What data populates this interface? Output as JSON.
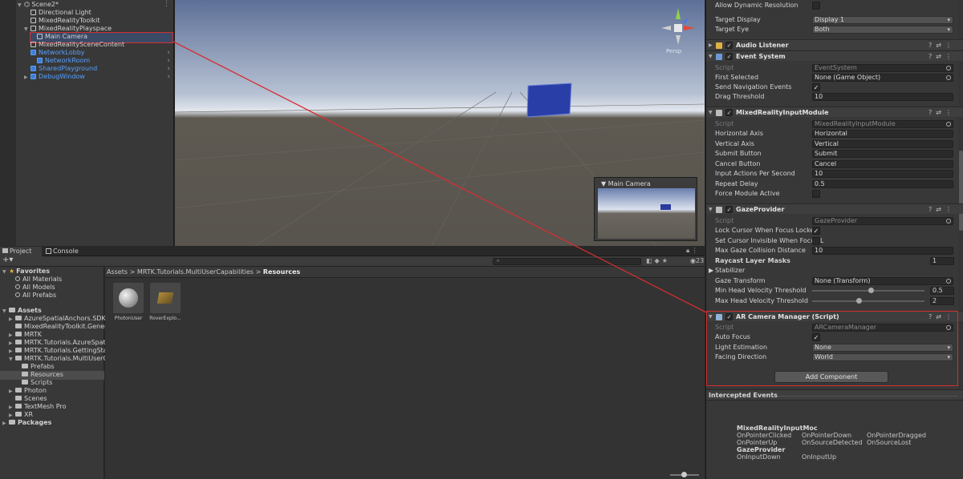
{
  "hierarchy": {
    "items": [
      {
        "label": "Scene2*",
        "type": "scene"
      },
      {
        "label": "Directional Light"
      },
      {
        "label": "MixedRealityToolkit"
      },
      {
        "label": "MixedRealityPlayspace"
      },
      {
        "label": "Main Camera"
      },
      {
        "label": "MixedRealitySceneContent"
      },
      {
        "label": "NetworkLobby"
      },
      {
        "label": "NetworkRoom"
      },
      {
        "label": "SharedPlayground"
      },
      {
        "label": "DebugWindow"
      }
    ]
  },
  "scene": {
    "gizmo_label": "Persp",
    "camera_preview_title": "Main Camera"
  },
  "bottom_tabs": {
    "project": "Project",
    "console": "Console"
  },
  "project": {
    "toolbar_count": "23",
    "tree": [
      {
        "label": "Favorites",
        "bold": true
      },
      {
        "label": "All Materials"
      },
      {
        "label": "All Models"
      },
      {
        "label": "All Prefabs"
      },
      {
        "label": "Assets",
        "bold": true
      },
      {
        "label": "AzureSpatialAnchors.SDK"
      },
      {
        "label": "MixedRealityToolkit.Generat"
      },
      {
        "label": "MRTK"
      },
      {
        "label": "MRTK.Tutorials.AzureSpatia"
      },
      {
        "label": "MRTK.Tutorials.GettingStart"
      },
      {
        "label": "MRTK.Tutorials.MultiUserCa"
      },
      {
        "label": "Prefabs"
      },
      {
        "label": "Resources"
      },
      {
        "label": "Scripts"
      },
      {
        "label": "Photon"
      },
      {
        "label": "Scenes"
      },
      {
        "label": "TextMesh Pro"
      },
      {
        "label": "XR"
      },
      {
        "label": "Packages",
        "bold": true
      }
    ],
    "breadcrumb": [
      "Assets",
      "MRTK.Tutorials.MultiUserCapabilities",
      "Resources"
    ],
    "assets": [
      {
        "label": "PhotonUser"
      },
      {
        "label": "RoverExplo..."
      }
    ]
  },
  "inspector": {
    "camera": {
      "allow_dynamic_resolution": "Allow Dynamic Resolution",
      "target_display_label": "Target Display",
      "target_display_value": "Display 1",
      "target_eye_label": "Target Eye",
      "target_eye_value": "Both"
    },
    "audio_listener": "Audio Listener",
    "event_system": {
      "title": "Event System",
      "script_label": "Script",
      "script_value": "EventSystem",
      "first_selected_label": "First Selected",
      "first_selected_value": "None (Game Object)",
      "send_nav_label": "Send Navigation Events",
      "drag_threshold_label": "Drag Threshold",
      "drag_threshold_value": "10"
    },
    "input_module": {
      "title": "MixedRealityInputModule",
      "script_label": "Script",
      "script_value": "MixedRealityInputModule",
      "horizontal_axis_label": "Horizontal Axis",
      "horizontal_axis_value": "Horizontal",
      "vertical_axis_label": "Vertical Axis",
      "vertical_axis_value": "Vertical",
      "submit_label": "Submit Button",
      "submit_value": "Submit",
      "cancel_label": "Cancel Button",
      "cancel_value": "Cancel",
      "actions_label": "Input Actions Per Second",
      "actions_value": "10",
      "repeat_label": "Repeat Delay",
      "repeat_value": "0.5",
      "force_label": "Force Module Active"
    },
    "gaze_provider": {
      "title": "GazeProvider",
      "script_label": "Script",
      "script_value": "GazeProvider",
      "lock_label": "Lock Cursor When Focus Locked",
      "invisible_label": "Set Cursor Invisible When Focus L",
      "max_gaze_label": "Max Gaze Collision Distance",
      "max_gaze_value": "10",
      "raycast_label": "Raycast Layer Masks",
      "raycast_value": "1",
      "stabilizer_label": "Stabilizer",
      "gaze_transform_label": "Gaze Transform",
      "gaze_transform_value": "None (Transform)",
      "min_head_label": "Min Head Velocity Threshold",
      "min_head_value": "0.5",
      "max_head_label": "Max Head Velocity Threshold",
      "max_head_value": "2"
    },
    "ar_camera_manager": {
      "title": "AR Camera Manager (Script)",
      "script_label": "Script",
      "script_value": "ARCameraManager",
      "auto_focus_label": "Auto Focus",
      "light_estimation_label": "Light Estimation",
      "light_estimation_value": "None",
      "facing_label": "Facing Direction",
      "facing_value": "World"
    },
    "add_component": "Add Component",
    "intercepted": {
      "title": "Intercepted Events",
      "group1": "MixedRealityInputMoc",
      "e1": "OnPointerClicked",
      "e2": "OnPointerDown",
      "e3": "OnPointerDragged",
      "e4": "OnPointerUp",
      "e5": "OnSourceDetected",
      "e6": "OnSourceLost",
      "group2": "GazeProvider",
      "e7": "OnInputDown",
      "e8": "OnInputUp"
    }
  },
  "colors": {
    "highlight": "#d32f2f",
    "selection": "#3a4a66",
    "link_blue": "#55a0ff"
  }
}
